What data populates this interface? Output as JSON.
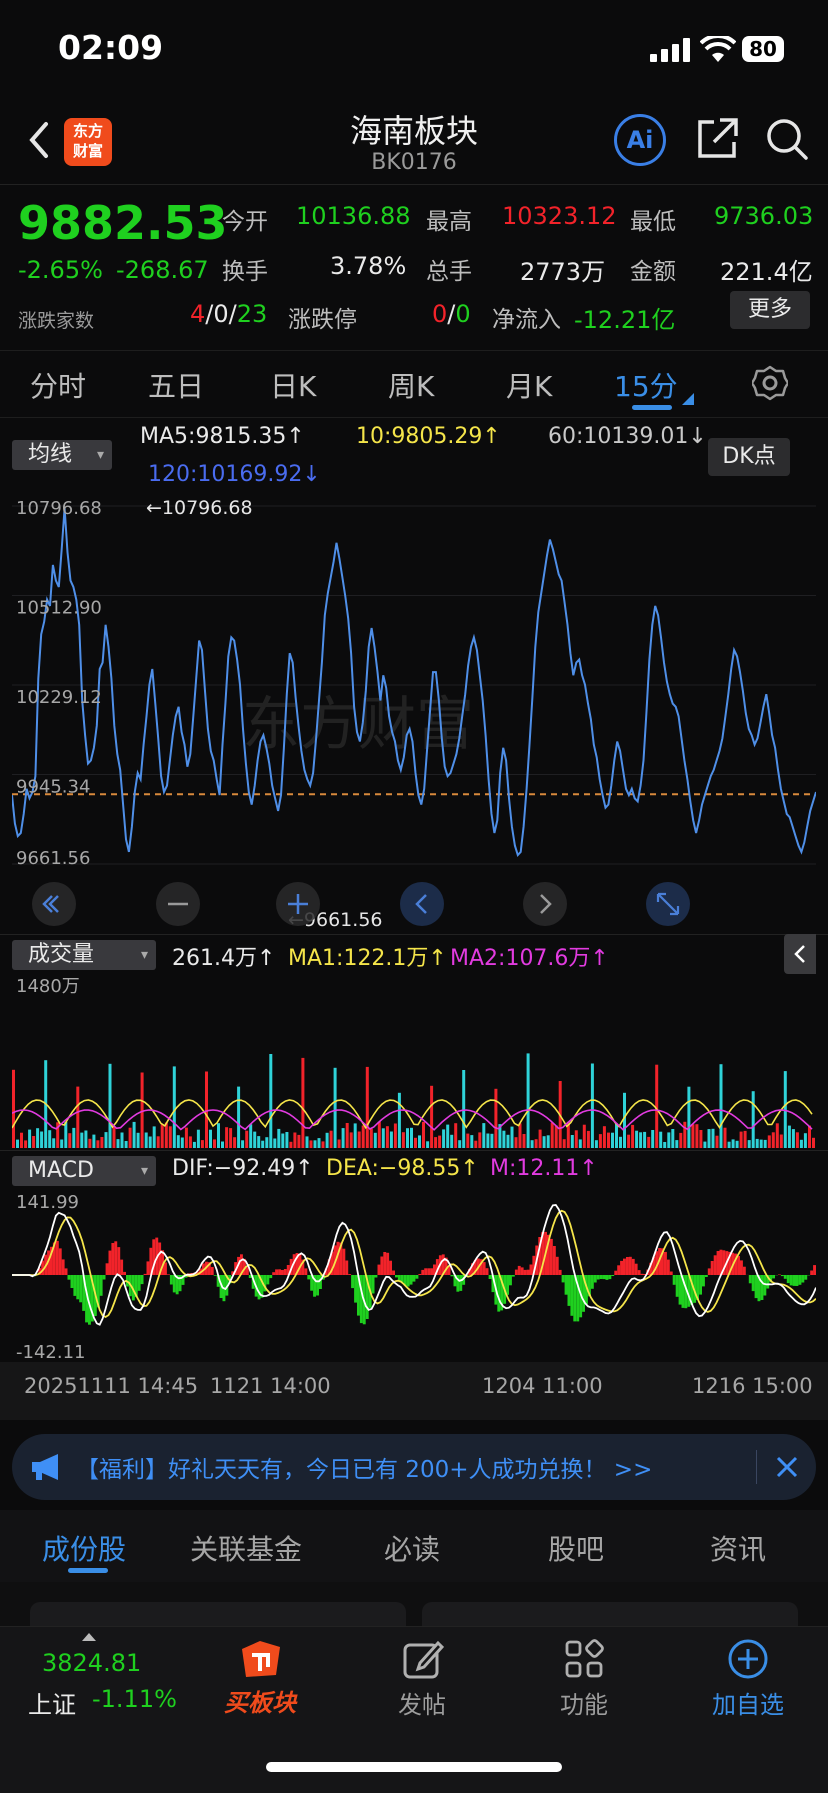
{
  "status_bar": {
    "time": "02:09",
    "battery": "80"
  },
  "header": {
    "back_icon": "chevron-left-icon",
    "logo_line1": "东方",
    "logo_line2": "财富",
    "title": "海南板块",
    "code": "BK0176",
    "ai_label": "Ai"
  },
  "quote": {
    "price": "9882.53",
    "change_pct": "-2.65%",
    "change_abs": "-268.67",
    "open_label": "今开",
    "open": "10136.88",
    "high_label": "最高",
    "high": "10323.12",
    "low_label": "最低",
    "low": "9736.03",
    "turnover_label": "换手",
    "turnover": "3.78%",
    "volume_label": "总手",
    "volume": "2773万",
    "amount_label": "金额",
    "amount": "221.4亿",
    "breadth_label": "涨跌家数",
    "breadth_up": "4",
    "breadth_sep1": "/",
    "breadth_flat": "0",
    "breadth_sep2": "/",
    "breadth_down": "23",
    "limit_label": "涨跌停",
    "limit_up": "0",
    "limit_sep": "/",
    "limit_down": "0",
    "netflow_label": "净流入",
    "netflow": "-12.21亿",
    "more_label": "更多"
  },
  "tabs": [
    {
      "label": "分时"
    },
    {
      "label": "五日"
    },
    {
      "label": "日K"
    },
    {
      "label": "周K"
    },
    {
      "label": "月K"
    },
    {
      "label": "15分"
    }
  ],
  "ma_bar": {
    "selector": "均线",
    "ma5": "MA5:9815.35↑",
    "ma10": "10:9805.29↑",
    "ma60": "60:10139.01↓",
    "ma120": "120:10169.92↓",
    "dk_label": "DK点"
  },
  "volume_bar": {
    "selector": "成交量",
    "vol": "261.4万↑",
    "ma1": "MA1:122.1万↑",
    "ma2": "MA2:107.6万↑",
    "max_label": "1480万"
  },
  "macd_bar": {
    "selector": "MACD",
    "dif": "DIF:−92.49↑",
    "dea": "DEA:−98.55↑",
    "m": "M:12.11↑",
    "max_label": "141.99",
    "min_label": "-142.11"
  },
  "chart_data": {
    "type": "line",
    "y_ticks": [
      "10796.68",
      "10512.90",
      "10229.12",
      "9945.34",
      "9661.56"
    ],
    "ylim": [
      9661.56,
      10796.68
    ],
    "high_marker": "←10796.68",
    "low_marker": "←9661.56",
    "reference_line": 9882.53,
    "x_labels": [
      "20251111 14:45",
      "1121 14:00",
      "1204 11:00",
      "1216 15:00"
    ],
    "series": [
      {
        "values": [
          9880,
          9790,
          9750,
          9760,
          9820,
          9900,
          9870,
          9890,
          9940,
          10250,
          10390,
          10430,
          10500,
          10480,
          10610,
          10560,
          10540,
          10660,
          10790,
          10650,
          10560,
          10540,
          10500,
          10420,
          10180,
          10070,
          9980,
          9990,
          10030,
          10100,
          10280,
          10300,
          10420,
          10350,
          10250,
          10100,
          10010,
          9960,
          9850,
          9740,
          9700,
          9780,
          9890,
          9950,
          9930,
          10040,
          10130,
          10230,
          10280,
          10170,
          10060,
          9940,
          9890,
          9910,
          9990,
          10070,
          10130,
          10160,
          10080,
          10040,
          9970,
          10010,
          10130,
          10250,
          10370,
          10340,
          10210,
          10090,
          10020,
          9990,
          9930,
          9880,
          10040,
          10170,
          10320,
          10380,
          10370,
          10310,
          10230,
          10090,
          9980,
          9890,
          9850,
          9910,
          9990,
          10050,
          10070,
          10030,
          9980,
          9910,
          9870,
          9830,
          9880,
          10030,
          10200,
          10330,
          10300,
          10190,
          10100,
          10020,
          9960,
          9930,
          9910,
          9950,
          10060,
          10180,
          10300,
          10450,
          10520,
          10570,
          10620,
          10680,
          10630,
          10570,
          10510,
          10440,
          10330,
          10160,
          10080,
          10050,
          10110,
          10210,
          10350,
          10410,
          10350,
          10270,
          10180,
          10260,
          10220,
          10130,
          10080,
          10050,
          9990,
          9960,
          10000,
          10070,
          10090,
          10050,
          9950,
          9880,
          9850,
          9900,
          10030,
          10150,
          10270,
          10270,
          10180,
          10060,
          9970,
          9940,
          9950,
          9980,
          10010,
          10060,
          10130,
          10200,
          10290,
          10350,
          10380,
          10340,
          10260,
          10180,
          10070,
          9930,
          9820,
          9760,
          9800,
          9950,
          10030,
          9990,
          9870,
          9780,
          9720,
          9690,
          9700,
          9780,
          9900,
          10040,
          10190,
          10350,
          10460,
          10520,
          10580,
          10640,
          10690,
          10660,
          10620,
          10580,
          10560,
          10490,
          10420,
          10330,
          10260,
          10300,
          10310,
          10260,
          10230,
          10170,
          10120,
          10040,
          10000,
          9930,
          9880,
          9840,
          9850,
          9910,
          9990,
          10050,
          10020,
          9960,
          9900,
          9880,
          9900,
          9870,
          9860,
          9910,
          9990,
          10140,
          10310,
          10420,
          10480,
          10450,
          10380,
          10300,
          10240,
          10200,
          10170,
          10160,
          10130,
          10060,
          9990,
          9930,
          9860,
          9800,
          9760,
          9800,
          9850,
          9880,
          9910,
          9940,
          9960,
          9990,
          10020,
          10060,
          10130,
          10200,
          10280,
          10340,
          10320,
          10270,
          10210,
          10140,
          10090,
          10070,
          10040,
          10060,
          10110,
          10160,
          10200,
          10140,
          10070,
          10030,
          9960,
          9900,
          9860,
          9820,
          9810,
          9780,
          9750,
          9720,
          9700,
          9730,
          9780,
          9830,
          9860,
          9890
        ]
      }
    ]
  },
  "banner": {
    "text": "【福利】好礼天天有，今日已有 200+人成功兑换！ >>"
  },
  "subtabs": [
    {
      "label": "成份股"
    },
    {
      "label": "关联基金"
    },
    {
      "label": "必读"
    },
    {
      "label": "股吧"
    },
    {
      "label": "资讯"
    }
  ],
  "bottom_nav": {
    "index_value": "3824.81",
    "index_name": "上证",
    "index_change": "-1.11%",
    "buy_label": "买板块",
    "post_label": "发帖",
    "func_label": "功能",
    "add_label": "加自选"
  },
  "colors": {
    "up": "#f2232a",
    "down": "#1fd01f",
    "accent": "#3a8ee6",
    "line": "#4f8fe8"
  }
}
